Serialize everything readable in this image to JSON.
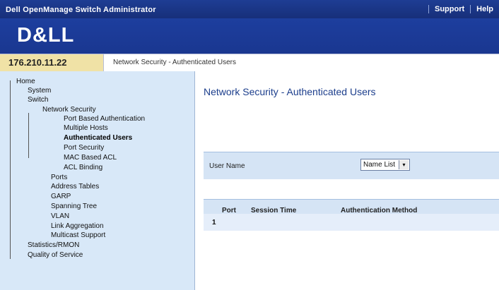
{
  "app": {
    "title": "Dell OpenManage Switch Administrator",
    "top_links": [
      "Support",
      "Help"
    ],
    "logo": "D&LL",
    "ip": "176.210.11.22",
    "breadcrumb": "Network Security - Authenticated Users"
  },
  "sidebar": {
    "items": [
      "Home",
      "System",
      "Switch",
      "Network Security",
      "Port Based Authentication",
      "Multiple Hosts",
      "Authenticated Users",
      "Port Security",
      "MAC Based ACL",
      "ACL Binding",
      "Ports",
      "Address Tables",
      "GARP",
      "Spanning Tree",
      "VLAN",
      "Link Aggregation",
      "Multicast Support",
      "Statistics/RMON",
      "Quality of Service"
    ]
  },
  "main": {
    "title": "Network Security - Authenticated Users",
    "filter": {
      "label": "User Name",
      "selected": "Name List"
    },
    "table": {
      "headers": [
        "Port",
        "Session Time",
        "Authentication Method"
      ],
      "rows": [
        {
          "num": "1"
        }
      ]
    }
  },
  "colors": {
    "header_blue": "#1d3e9e",
    "sidebar_bg": "#d8e8f8",
    "ip_box": "#f0e2a6",
    "title_blue": "#1c3e8c",
    "panel": "#d5e4f5"
  }
}
